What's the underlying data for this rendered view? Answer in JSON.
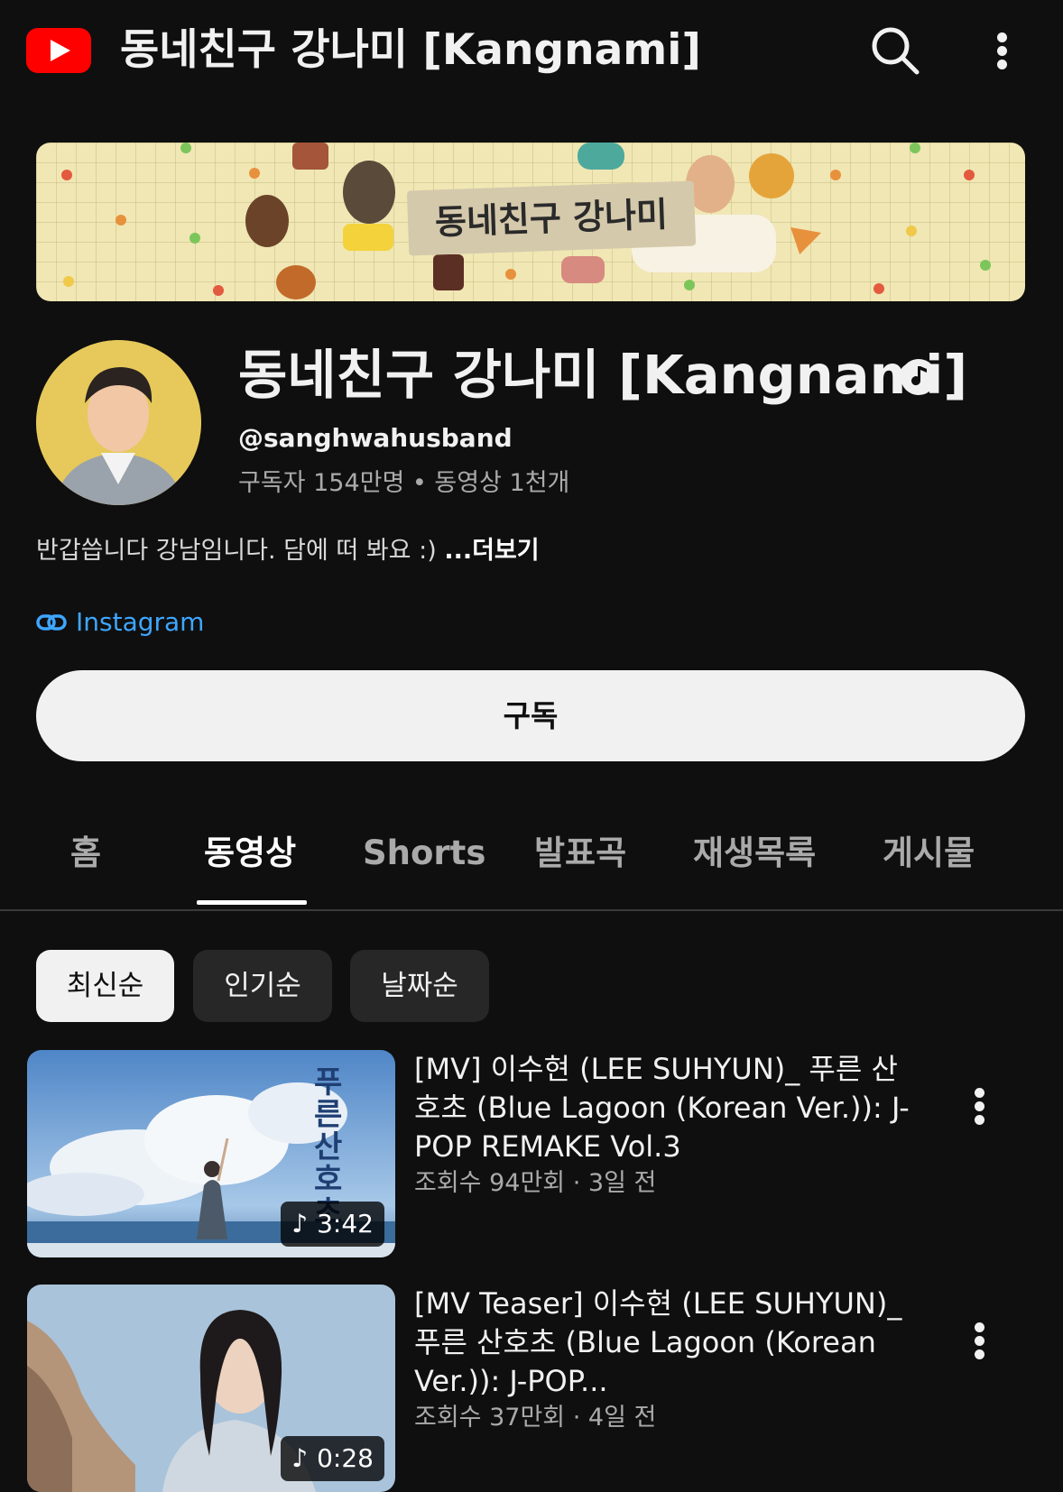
{
  "header": {
    "logo": "youtube-logo",
    "title": "동네친구 강나미 [Kangnami]",
    "search_icon": "search-icon",
    "more_icon": "more-vert-icon"
  },
  "banner": {
    "label": "동네친구 강나미"
  },
  "channel": {
    "name": "동네친구 강나미 [Kangnami]",
    "verified_icon": "music-verified-icon",
    "handle": "@sanghwahusband",
    "stats": "구독자 154만명 • 동영상 1천개",
    "description": "반갑씁니다 강남임니다. 담에 떠 봐요 :) ",
    "more_label": "...더보기",
    "link_icon": "link-icon",
    "link_label": "Instagram",
    "subscribe_label": "구독"
  },
  "tabs": [
    {
      "label": "홈",
      "active": false
    },
    {
      "label": "동영상",
      "active": true
    },
    {
      "label": "Shorts",
      "active": false
    },
    {
      "label": "발표곡",
      "active": false
    },
    {
      "label": "재생목록",
      "active": false
    },
    {
      "label": "게시물",
      "active": false
    }
  ],
  "sort_chips": [
    {
      "label": "최신순",
      "selected": true
    },
    {
      "label": "인기순",
      "selected": false
    },
    {
      "label": "날짜순",
      "selected": false
    }
  ],
  "videos": [
    {
      "title": "[MV] 이수현 (LEE SUHYUN)_ 푸른 산호초 (Blue Lagoon (Korean Ver.)): J-POP REMAKE Vol.3",
      "meta": "조회수 94만회 · 3일 전",
      "duration": "3:42",
      "duration_icon": "music-note-icon",
      "thumb_text": "푸른 산호초"
    },
    {
      "title": "[MV Teaser] 이수현 (LEE SUHYUN)_ 푸른 산호초 (Blue Lagoon (Korean Ver.)): J-POP...",
      "meta": "조회수 37만회 · 4일 전",
      "duration": "0:28",
      "duration_icon": "music-note-icon",
      "thumb_text": ""
    }
  ],
  "colors": {
    "background": "#0f0f0f",
    "youtube_red": "#ff0000",
    "link_blue": "#3ea6ff",
    "muted_text": "#aaaaaa"
  }
}
